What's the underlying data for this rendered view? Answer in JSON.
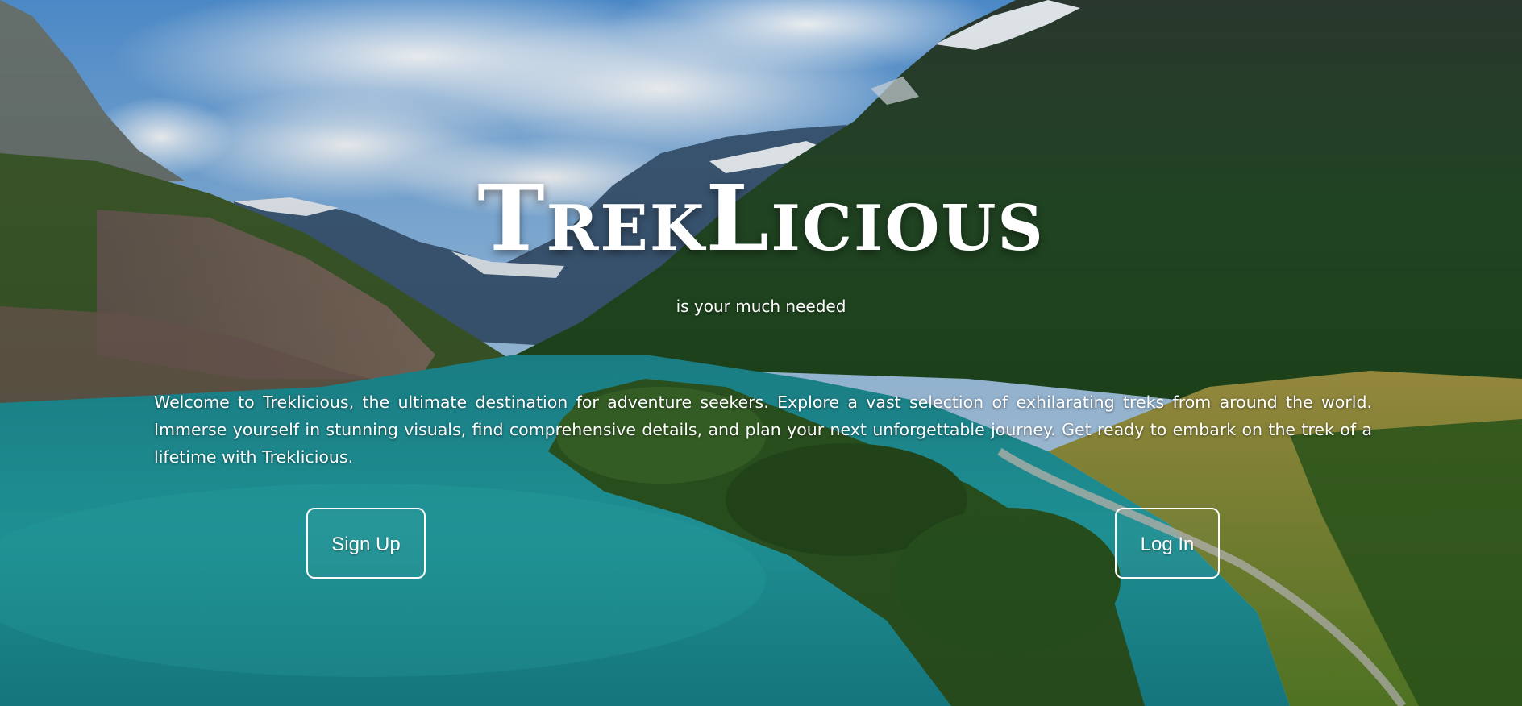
{
  "hero": {
    "title": "TrekLicious",
    "subtitle": "is your much needed",
    "welcome_text": "Welcome to Treklicious, the ultimate destination for adventure seekers. Explore a vast selection of exhilarating treks from around the world. Immerse yourself in stunning visuals, find comprehensive details, and plan your next unforgettable journey. Get ready to embark on the trek of a lifetime with Treklicious."
  },
  "actions": {
    "signup_label": "Sign Up",
    "login_label": "Log In"
  },
  "colors": {
    "text": "#ffffff",
    "button_border": "#ffffff",
    "lake": "#1fa3a6",
    "forest": "#2e5a24",
    "sky": "#7fb3e0"
  }
}
